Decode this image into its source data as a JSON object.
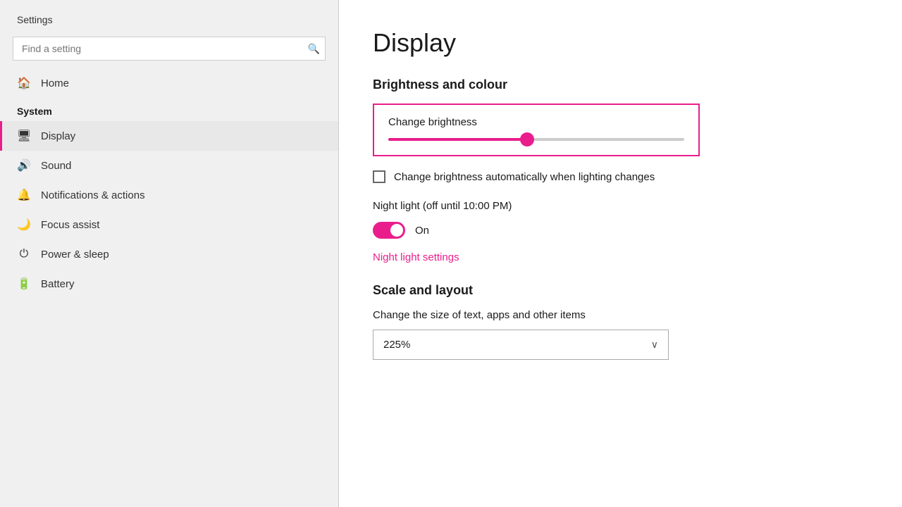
{
  "app": {
    "title": "Settings"
  },
  "sidebar": {
    "title": "Settings",
    "search_placeholder": "Find a setting",
    "home_label": "Home",
    "system_label": "System",
    "nav_items": [
      {
        "id": "display",
        "label": "Display",
        "icon": "🖥",
        "active": true
      },
      {
        "id": "sound",
        "label": "Sound",
        "icon": "🔊",
        "active": false
      },
      {
        "id": "notifications",
        "label": "Notifications & actions",
        "icon": "🔔",
        "active": false
      },
      {
        "id": "focus",
        "label": "Focus assist",
        "icon": "🌙",
        "active": false
      },
      {
        "id": "power",
        "label": "Power & sleep",
        "icon": "⏻",
        "active": false
      },
      {
        "id": "battery",
        "label": "Battery",
        "icon": "🔋",
        "active": false
      }
    ]
  },
  "main": {
    "page_title": "Display",
    "brightness_section": {
      "heading": "Brightness and colour",
      "brightness_label": "Change brightness",
      "auto_brightness_label": "Change brightness automatically when lighting changes",
      "slider_value": 47
    },
    "night_light": {
      "label": "Night light (off until 10:00 PM)",
      "toggle_state": "On",
      "link_label": "Night light settings"
    },
    "scale_section": {
      "heading": "Scale and layout",
      "description": "Change the size of text, apps and other items",
      "dropdown_value": "225%"
    }
  },
  "icons": {
    "search": "🔍",
    "home": "🏠",
    "chevron_down": "⌄"
  }
}
